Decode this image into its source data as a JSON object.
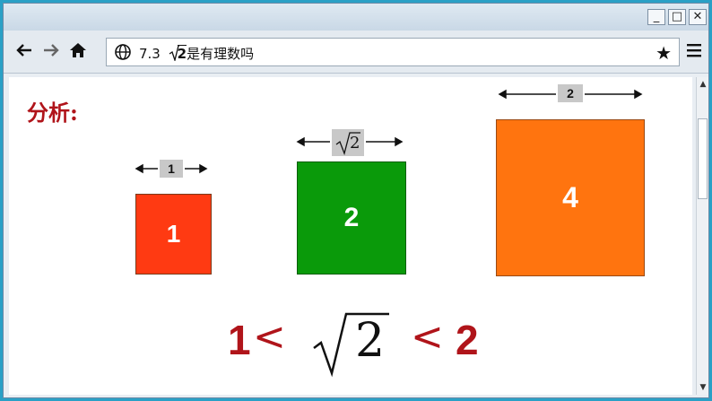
{
  "window": {
    "minimize_label": "_",
    "maximize_label": "□",
    "close_label": "✕"
  },
  "toolbar": {
    "back_icon": "back-arrow-icon",
    "forward_icon": "forward-arrow-icon",
    "home_icon": "home-icon",
    "address_prefix": "7.3 ",
    "address_sqrt_arg": "2",
    "address_suffix": "是有理数吗",
    "bookmark_icon": "star-icon",
    "menu_icon": "hamburger-menu-icon"
  },
  "slide": {
    "heading": "分析:",
    "squares": [
      {
        "side_label": "1",
        "area_label": "1",
        "color": "#ff3a12"
      },
      {
        "side_label_sqrt_arg": "2",
        "area_label": "2",
        "color": "#0a9a0a"
      },
      {
        "side_label": "2",
        "area_label": "4",
        "color": "#ff740f"
      }
    ],
    "inequality": {
      "left": "1",
      "lt1": "<",
      "sqrt_arg": "2",
      "lt2": "<",
      "right": "2"
    }
  },
  "colors": {
    "accent_red": "#b0141a",
    "background": "#2aa0c6"
  }
}
